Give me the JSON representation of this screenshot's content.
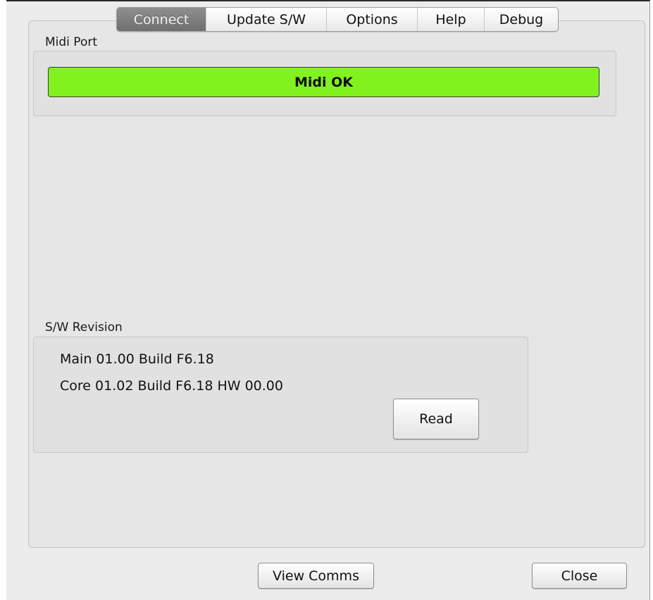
{
  "tabs": [
    {
      "label": "Connect",
      "active": true
    },
    {
      "label": "Update S/W",
      "active": false
    },
    {
      "label": "Options",
      "active": false
    },
    {
      "label": "Help",
      "active": false
    },
    {
      "label": "Debug",
      "active": false
    }
  ],
  "midi_port": {
    "label": "Midi Port",
    "status_text": "Midi OK",
    "status_color": "#82f21e"
  },
  "sw_revision": {
    "label": "S/W Revision",
    "main_line": "Main 01.00 Build F6.18",
    "core_line": "Core 01.02 Build F6.18 HW 00.00",
    "read_button": "Read"
  },
  "footer": {
    "view_comms_button": "View Comms",
    "close_button": "Close"
  },
  "colors": {
    "window_bg": "#ececec",
    "active_tab": "#7d7d7d"
  }
}
